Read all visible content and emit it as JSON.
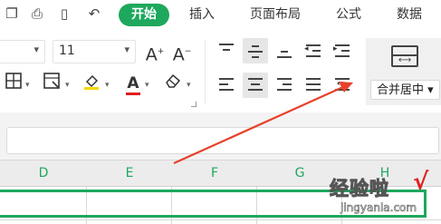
{
  "menubar": {
    "tabs": [
      {
        "label": "开始",
        "active": true
      },
      {
        "label": "插入",
        "active": false
      },
      {
        "label": "页面布局",
        "active": false
      },
      {
        "label": "公式",
        "active": false
      },
      {
        "label": "数据",
        "active": false
      }
    ]
  },
  "ribbon": {
    "font_size_value": "11",
    "merge_label": "合并居中",
    "merge_caret": "▾",
    "font_color": "#e02020",
    "fill_color": "#f5d800"
  },
  "column_headers": [
    "D",
    "E",
    "F",
    "G",
    "H"
  ],
  "accent_color": "#1ea85d",
  "watermark": {
    "text": "经验啦",
    "check": "√",
    "sub": "jingyanla.com"
  }
}
